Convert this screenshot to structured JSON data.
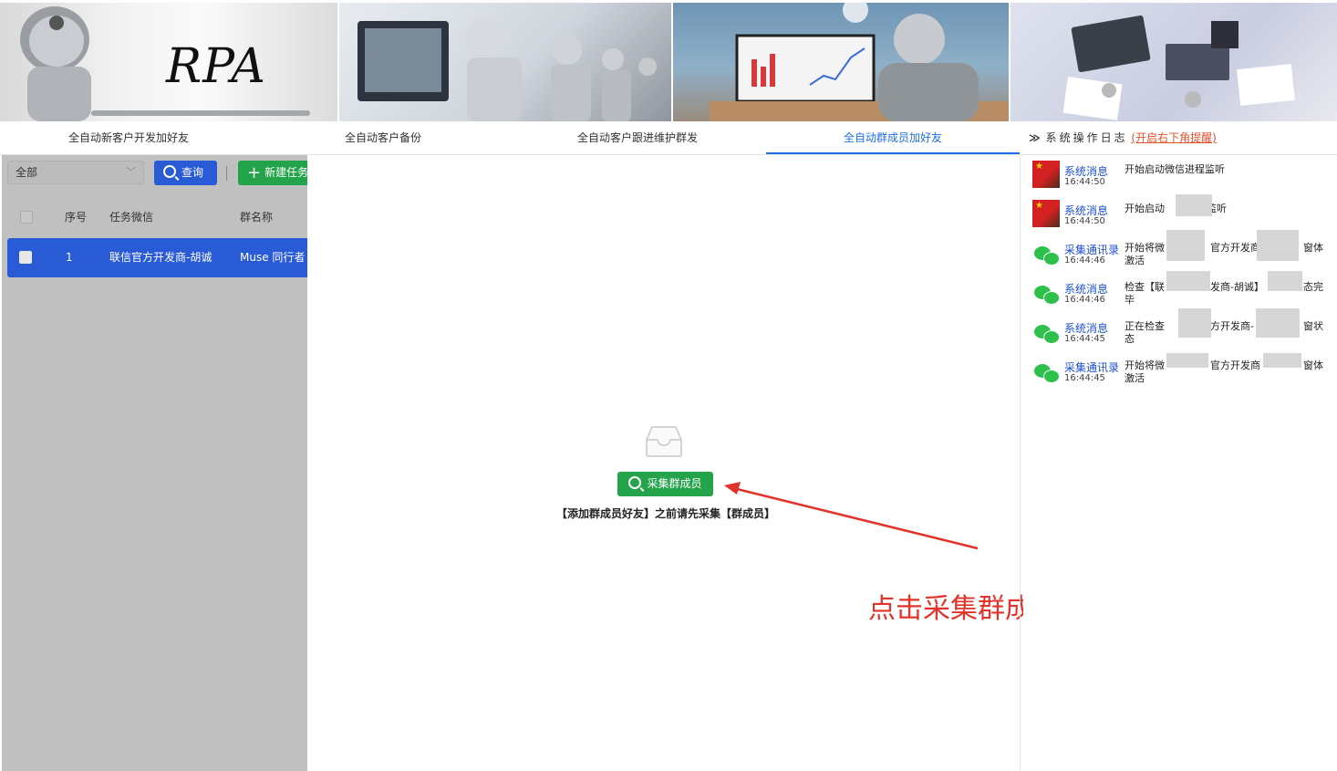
{
  "banner": {
    "logo_text": "RPA"
  },
  "tabs": [
    {
      "label": "全自动新客户开发加好友"
    },
    {
      "label": "全自动客户备份"
    },
    {
      "label": "全自动客户跟进维护群发"
    },
    {
      "label": "全自动群成员加好友",
      "active": true
    }
  ],
  "log_panel": {
    "title": "系统操作日志",
    "link": "(开启右下角提醒)",
    "items": [
      {
        "source": "系统消息",
        "time": "16:44:50",
        "message": "开始启动微信进程监听",
        "avatar": "flag"
      },
      {
        "source": "系统消息",
        "time": "16:44:50",
        "message": "开始启动",
        "avatar": "flag",
        "message_tail": "监听"
      },
      {
        "source": "采集通讯录",
        "time": "16:44:46",
        "message": "开始将微",
        "avatar": "wechat",
        "message_mid": "官方开发商",
        "message_tail": "窗体",
        "message_line2": "激活"
      },
      {
        "source": "系统消息",
        "time": "16:44:46",
        "message": "检查【联",
        "avatar": "wechat",
        "message_mid": "发商-胡诚】",
        "message_tail": "态完",
        "message_line2": "毕"
      },
      {
        "source": "系统消息",
        "time": "16:44:45",
        "message": "正在检查",
        "avatar": "wechat",
        "message_mid": "方开发商-",
        "message_tail": "窗状",
        "message_line2": "态"
      },
      {
        "source": "采集通讯录",
        "time": "16:44:45",
        "message": "开始将微",
        "avatar": "wechat",
        "message_mid": "官方开发商",
        "message_tail": "窗体",
        "message_line2": "激活"
      }
    ]
  },
  "left_panel": {
    "filter_value": "全部",
    "query_button": "查询",
    "new_task_button": "新建任务",
    "columns": [
      "序号",
      "任务微信",
      "群名称"
    ],
    "rows": [
      {
        "index": "1",
        "wechat": "联信官方开发商-胡诚",
        "group": "Muse 同行者"
      }
    ]
  },
  "center": {
    "collect_button": "采集群成员",
    "hint": "【添加群成员好友】之前请先采集【群成员】"
  },
  "annotation": {
    "text": "点击采集群成员",
    "color": "#e2332b"
  },
  "colors": {
    "primary_blue": "#2a5bd7",
    "active_tab": "#1e6fe5",
    "green": "#23a34a",
    "link_red": "#e0522b"
  }
}
